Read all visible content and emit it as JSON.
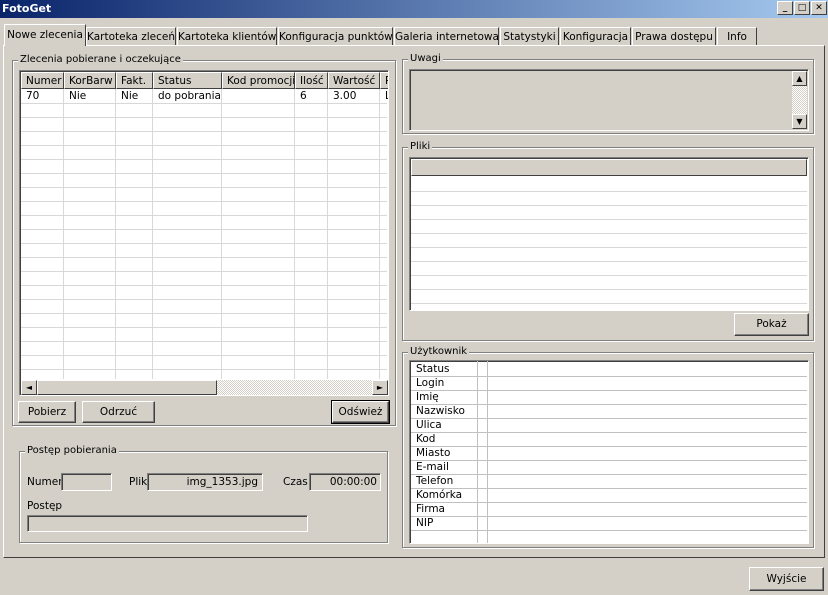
{
  "window": {
    "title": "FotoGet",
    "minimize_glyph": "_",
    "maximize_glyph": "□",
    "close_glyph": "✕"
  },
  "tabs": [
    {
      "label": "Nowe zlecenia",
      "active": true
    },
    {
      "label": "Kartoteka zleceń"
    },
    {
      "label": "Kartoteka klientów"
    },
    {
      "label": "Konfiguracja punktów"
    },
    {
      "label": "Galeria internetowa"
    },
    {
      "label": "Statystyki"
    },
    {
      "label": "Konfiguracja"
    },
    {
      "label": "Prawa dostępu"
    },
    {
      "label": "Info"
    }
  ],
  "orders": {
    "title": "Zlecenia pobierane i oczekujące",
    "columns": [
      "Numer",
      "KorBarw",
      "Fakt.",
      "Status",
      "Kod promocji",
      "Ilość",
      "Wartość",
      "P"
    ],
    "rows": [
      [
        "70",
        "Nie",
        "Nie",
        "do pobrania",
        "",
        "6",
        "3.00",
        "L"
      ]
    ],
    "scroll_left_glyph": "◄",
    "scroll_right_glyph": "►"
  },
  "actions": {
    "download": "Pobierz",
    "reject": "Odrzuć",
    "refresh": "Odśwież"
  },
  "progress": {
    "title": "Postęp pobierania",
    "number_label": "Numer",
    "number_value": "",
    "file_label": "Plik",
    "file_value": "img_1353.jpg",
    "time_label": "Czas",
    "time_value": "00:00:00",
    "progress_label": "Postęp",
    "progress_fraction": 0
  },
  "notes": {
    "title": "Uwagi",
    "value": "",
    "scroll_up_glyph": "▲",
    "scroll_down_glyph": "▼"
  },
  "files": {
    "title": "Pliki",
    "show_button": "Pokaż"
  },
  "user": {
    "title": "Użytkownik",
    "fields": [
      "Status",
      "Login",
      "Imię",
      "Nazwisko",
      "Ulica",
      "Kod",
      "Miasto",
      "E-mail",
      "Telefon",
      "Komórka",
      "Firma",
      "NIP"
    ]
  },
  "footer": {
    "exit_button": "Wyjście"
  }
}
